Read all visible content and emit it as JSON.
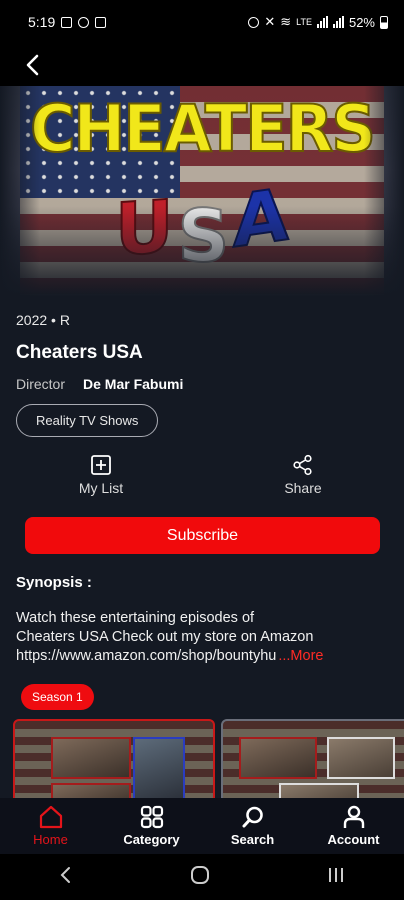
{
  "status_bar": {
    "time": "5:19",
    "network": "LTE",
    "battery": "52%"
  },
  "show": {
    "poster_title_line1": "CHEATERS",
    "poster_title_u": "U",
    "poster_title_s": "S",
    "poster_title_a": "A",
    "meta": "2022 • R",
    "title": "Cheaters USA",
    "director_label": "Director",
    "director_name": "De Mar Fabumi",
    "genre": "Reality TV Shows"
  },
  "actions": {
    "my_list": "My List",
    "share": "Share"
  },
  "subscribe_label": "Subscribe",
  "synopsis": {
    "heading": "Synopsis :",
    "line1": "Watch these entertaining episodes of",
    "line2": "Cheaters USA Check out my store on Amazon",
    "line3": "https://www.amazon.com/shop/bountyhu",
    "more": "...More"
  },
  "season_label": "Season 1",
  "bottom_nav": {
    "home": "Home",
    "category": "Category",
    "search": "Search",
    "account": "Account"
  },
  "icons": {
    "back": "back-arrow-icon",
    "add_list": "add-square-icon",
    "share": "share-icon",
    "home": "home-icon",
    "category": "grid-icon",
    "search": "search-icon",
    "account": "person-icon"
  },
  "colors": {
    "accent": "#f10a0c",
    "background": "#141923",
    "nav_background": "#0d1019"
  }
}
